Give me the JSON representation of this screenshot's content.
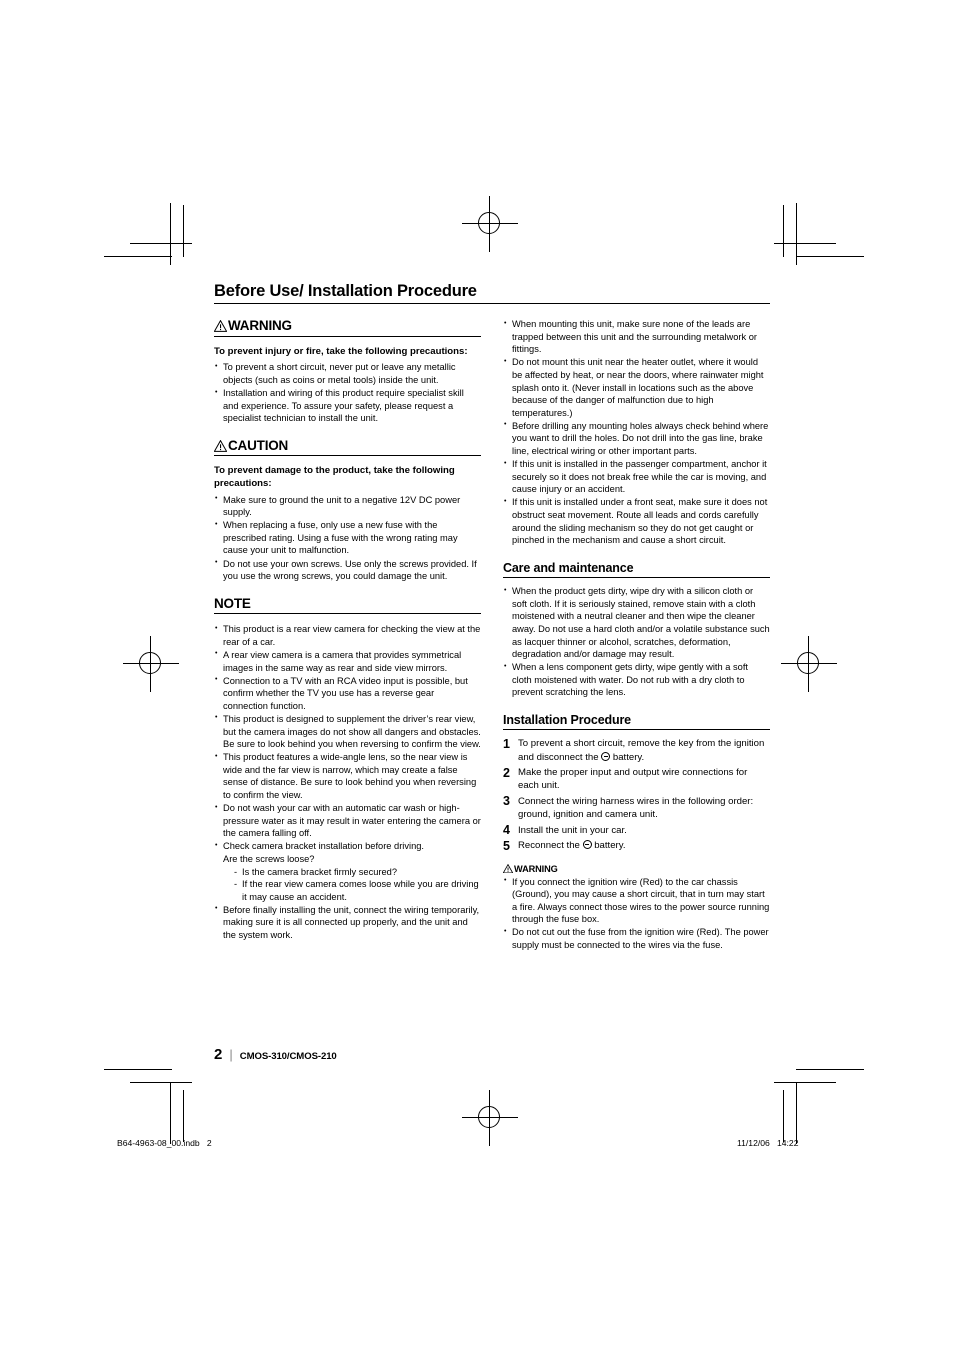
{
  "document": {
    "title": "Before Use/ Installation Procedure",
    "folio": "2",
    "folio_separator": "|",
    "model": "CMOS-310/CMOS-210",
    "slug_left": "B64-4963-08_00.indb   2",
    "slug_right": "11/12/06   14:22"
  },
  "left_column": {
    "warning": {
      "heading": "WARNING",
      "icon": "warning-triangle-icon",
      "subheading": "To prevent injury or fire, take the following precautions:",
      "bullets": [
        "To prevent a short circuit, never put or leave any metallic objects (such as coins or metal tools) inside the unit.",
        "Installation and wiring of this product require specialist skill and experience. To assure your safety, please request a specialist technician to install the unit."
      ]
    },
    "caution": {
      "heading": "CAUTION",
      "icon": "warning-triangle-icon",
      "subheading": "To prevent damage to the product, take the following precautions:",
      "bullets": [
        "Make sure to ground the unit to a negative 12V DC power supply.",
        "When replacing a fuse, only use a new fuse with the prescribed rating. Using a fuse with the wrong rating may cause your unit to malfunction.",
        "Do not use your own screws. Use only the screws provided. If you use the wrong screws, you could damage the unit."
      ]
    },
    "note": {
      "heading": "NOTE",
      "bullets": [
        "This product is a rear view camera for checking the view at the rear of a car.",
        "A rear view camera is a camera that provides symmetrical images in the same way as rear and side view mirrors.",
        "Connection to a TV with an RCA video input is possible, but confirm whether the TV you use has a reverse gear connection function.",
        "This product is designed to supplement the driver’s rear view, but the camera images do not show all dangers and obstacles. Be sure to look behind you when reversing to confirm the view.",
        "This product features a wide-angle lens, so the near view is wide and the far view is narrow, which may create a false sense of distance. Be sure to look behind you when reversing to confirm the view.",
        "Do not wash your car with an automatic car wash or high-pressure water as it may result in water entering the camera or the camera falling off."
      ],
      "bracket_bullet": {
        "line1": "Check camera bracket installation before driving.",
        "line2": "Are the screws loose?",
        "sub_items": [
          "Is the camera bracket firmly secured?",
          "If the rear view camera comes loose while you are driving it may cause an accident."
        ]
      },
      "final_bullet": "Before finally installing the unit, connect the wiring temporarily, making sure it is all connected up properly, and the unit and the system work."
    }
  },
  "right_column": {
    "warning_continued": [
      "When mounting this unit, make sure none of the leads are trapped between this unit and the surrounding metalwork or fittings.",
      "Do not mount this unit near the heater outlet, where it would be affected by heat, or near the doors, where rainwater might splash onto it. (Never install in locations such as the above because of the danger of malfunction due to high temperatures.)",
      "Before drilling any mounting holes always check behind where you want to drill the holes. Do not drill into the gas line, brake line, electrical wiring or other important parts.",
      "If this unit is installed in the passenger compartment, anchor it securely so it does not break free while the car is moving, and cause injury or an accident.",
      "If this unit is installed under a front seat, make sure it does not obstruct seat movement. Route all leads and cords carefully around the sliding mechanism so they do not get caught or pinched in the mechanism and cause a short circuit."
    ],
    "care": {
      "heading": "Care and maintenance",
      "bullets": [
        "When the product gets dirty, wipe dry with a silicon cloth or soft cloth. If it is seriously stained, remove stain with a cloth moistened with a neutral cleaner and then wipe the cleaner away. Do not use a hard cloth and/or a volatile substance such as lacquer thinner or alcohol, scratches, deformation, degradation and/or damage may result.",
        "When a lens component gets dirty, wipe gently with a soft cloth moistened with water. Do not rub with a dry cloth to prevent scratching the lens."
      ]
    },
    "installation": {
      "heading": "Installation Procedure",
      "steps": [
        {
          "before": "To prevent a short circuit, remove the key from the ignition and disconnect the ",
          "symbol": "circled-minus-icon",
          "after": " battery."
        },
        {
          "before": "Make the proper input and output wire connections for each unit.",
          "symbol": null,
          "after": ""
        },
        {
          "before": "Connect the wiring harness wires in the following order: ground, ignition and camera unit.",
          "symbol": null,
          "after": ""
        },
        {
          "before": "Install the unit in your car.",
          "symbol": null,
          "after": ""
        },
        {
          "before": "Reconnect the ",
          "symbol": "circled-minus-icon",
          "after": " battery."
        }
      ]
    },
    "warning_box": {
      "heading": "WARNING",
      "icon": "warning-triangle-icon",
      "bullets": [
        "If you connect the ignition wire (Red) to the car chassis (Ground), you may cause a short circuit, that in turn may start a fire. Always connect those wires to the power source running through the fuse box.",
        "Do not cut out the fuse from the ignition wire (Red). The power supply must be connected to the wires via the fuse."
      ]
    }
  }
}
